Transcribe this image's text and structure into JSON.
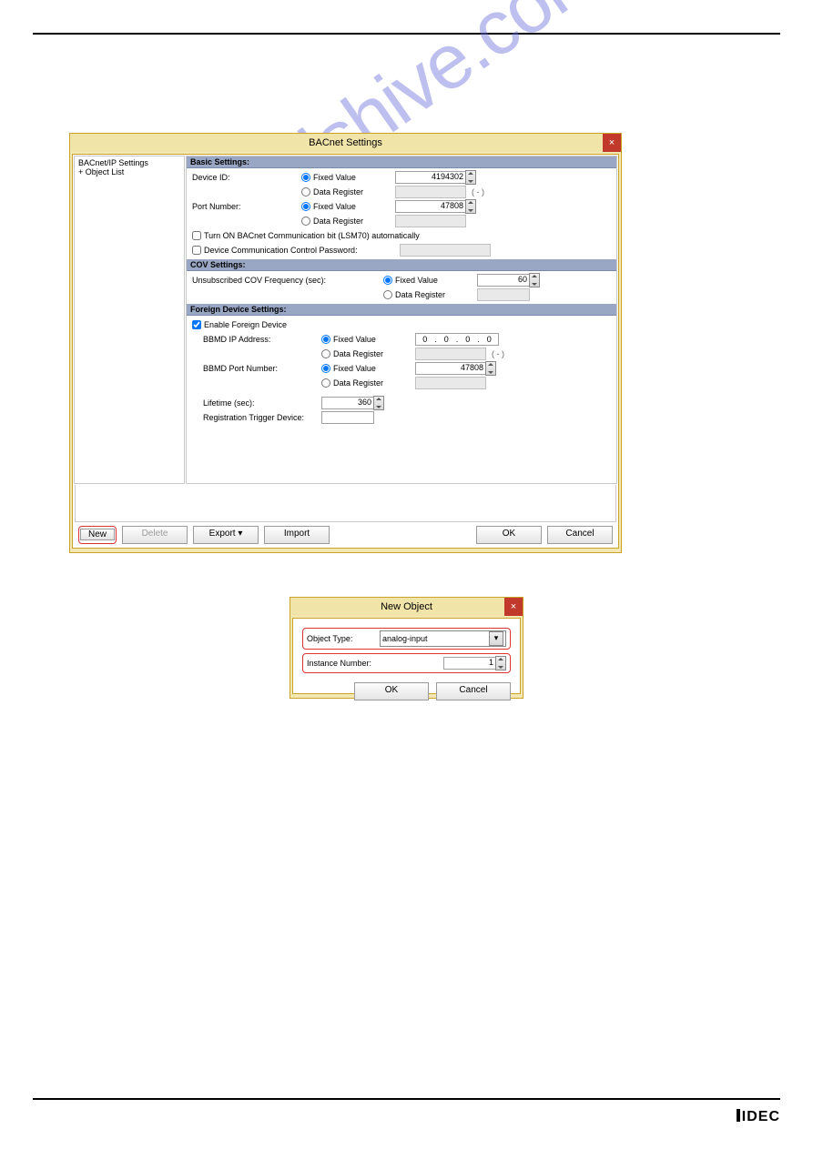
{
  "watermark_text": "manualshive.com",
  "logo_text": "IDEC",
  "win1": {
    "title": "BACnet Settings",
    "close": "×",
    "tree": {
      "item1": "BACnet/IP Settings",
      "item2_prefix": "+ ",
      "item2": "Object List"
    },
    "sections": {
      "basic": {
        "head": "Basic Settings:",
        "device_id_label": "Device ID:",
        "fixed_value": "Fixed Value",
        "data_register": "Data Register",
        "device_id_val": "4194302",
        "port_label": "Port Number:",
        "port_val": "47808",
        "paren": "( - )",
        "chk1": "Turn ON BACnet Communication bit (LSM70) automatically",
        "chk2": "Device Communication Control Password:"
      },
      "cov": {
        "head": "COV Settings:",
        "label": "Unsubscribed COV Frequency (sec):",
        "val": "60"
      },
      "foreign": {
        "head": "Foreign Device Settings:",
        "enable": "Enable Foreign Device",
        "ip_label": "BBMD IP Address:",
        "ip_o1": "0",
        "ip_o2": "0",
        "ip_o3": "0",
        "ip_o4": "0",
        "port_label": "BBMD Port Number:",
        "port_val": "47808",
        "lifetime_label": "Lifetime (sec):",
        "lifetime_val": "360",
        "trigger_label": "Registration Trigger Device:"
      }
    },
    "buttons": {
      "new": "New",
      "delete": "Delete",
      "export": "Export",
      "export_caret": "▾",
      "import": "Import",
      "ok": "OK",
      "cancel": "Cancel"
    }
  },
  "win2": {
    "title": "New Object",
    "close": "×",
    "obj_type_label": "Object Type:",
    "obj_type_val": "analog-input",
    "instance_label": "Instance Number:",
    "instance_val": "1",
    "ok": "OK",
    "cancel": "Cancel"
  }
}
